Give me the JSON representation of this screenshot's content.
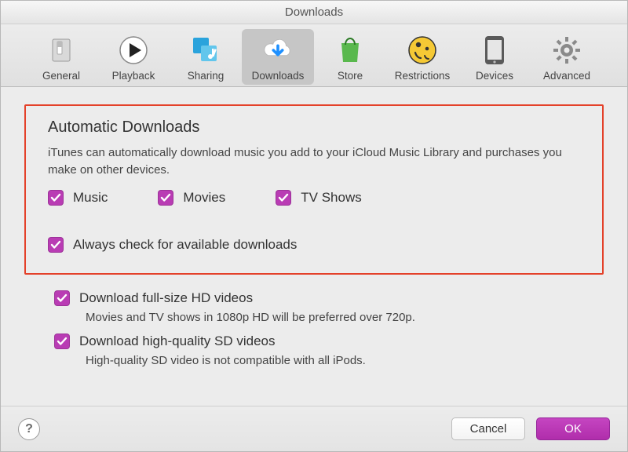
{
  "window_title": "Downloads",
  "tabs": [
    {
      "label": "General"
    },
    {
      "label": "Playback"
    },
    {
      "label": "Sharing"
    },
    {
      "label": "Downloads"
    },
    {
      "label": "Store"
    },
    {
      "label": "Restrictions"
    },
    {
      "label": "Devices"
    },
    {
      "label": "Advanced"
    }
  ],
  "section_title": "Automatic Downloads",
  "section_desc": "iTunes can automatically download music you add to your iCloud Music Library and purchases you make on other devices.",
  "opts": {
    "music": "Music",
    "movies": "Movies",
    "tvshows": "TV Shows",
    "always_check": "Always check for available downloads",
    "full_hd": "Download full-size HD videos",
    "full_hd_sub": "Movies and TV shows in 1080p HD will be preferred over 720p.",
    "hq_sd": "Download high-quality SD videos",
    "hq_sd_sub": "High-quality SD video is not compatible with all iPods."
  },
  "buttons": {
    "cancel": "Cancel",
    "ok": "OK"
  },
  "help_glyph": "?",
  "accent": "#b93cb4"
}
